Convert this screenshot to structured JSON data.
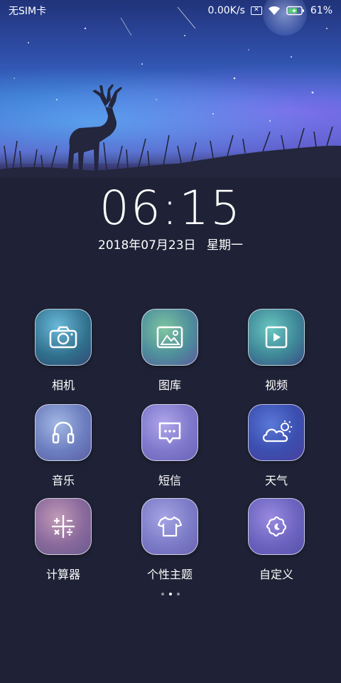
{
  "status_bar": {
    "carrier": "无SIM卡",
    "network_speed": "0.00K/s",
    "battery_percent": "61%",
    "icons": [
      "no-sim-box-icon",
      "wifi-icon",
      "battery-charging-icon"
    ]
  },
  "lock": {
    "time": "06:15",
    "date": "2018年07月23日",
    "weekday": "星期一"
  },
  "apps": [
    {
      "label": "相机",
      "icon": "camera-icon"
    },
    {
      "label": "图库",
      "icon": "gallery-icon"
    },
    {
      "label": "视频",
      "icon": "video-icon"
    },
    {
      "label": "音乐",
      "icon": "headphones-icon"
    },
    {
      "label": "短信",
      "icon": "message-icon"
    },
    {
      "label": "天气",
      "icon": "weather-icon"
    },
    {
      "label": "计算器",
      "icon": "calculator-icon"
    },
    {
      "label": "个性主题",
      "icon": "theme-shirt-icon"
    },
    {
      "label": "自定义",
      "icon": "customize-icon"
    }
  ],
  "pager": {
    "pages": 3,
    "current": 2
  }
}
